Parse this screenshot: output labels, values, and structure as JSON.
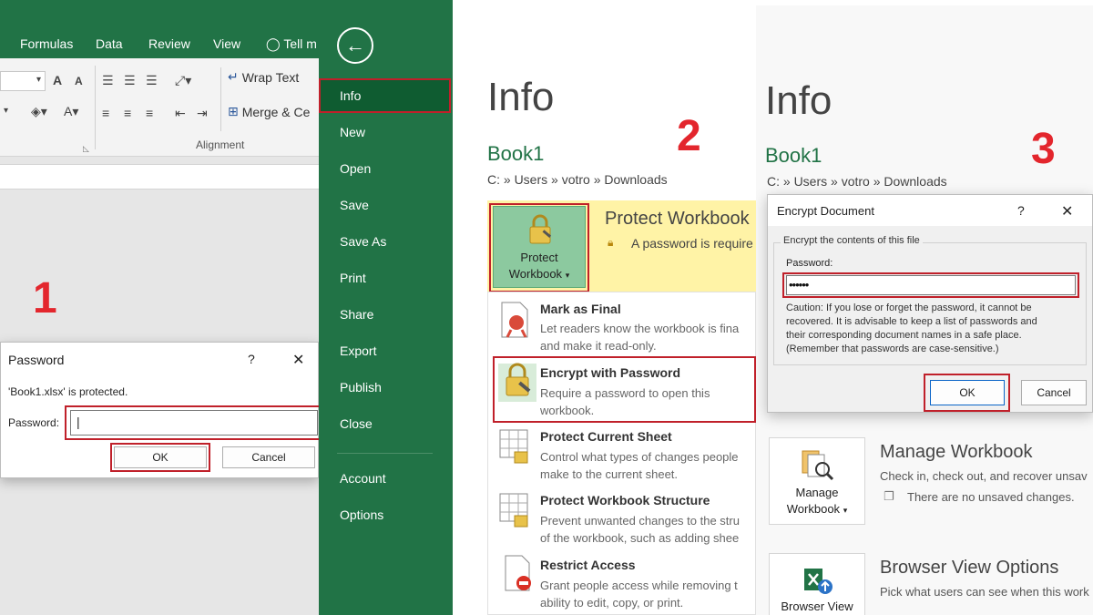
{
  "panel1": {
    "tabs": [
      "Formulas",
      "Data",
      "Review",
      "View",
      "Tell m"
    ],
    "ribbon": {
      "wrap_text": "Wrap Text",
      "merge": "Merge & Ce",
      "alignment": "Alignment",
      "font_increase": "A",
      "font_decrease": "A",
      "font_color": "A"
    },
    "step": "1",
    "dialog": {
      "title": "Password",
      "help": "?",
      "close": "✕",
      "message": "'Book1.xlsx' is protected.",
      "password_label": "Password:",
      "ok": "OK",
      "cancel": "Cancel"
    }
  },
  "panel2": {
    "nav": [
      "Info",
      "New",
      "Open",
      "Save",
      "Save As",
      "Print",
      "Share",
      "Export",
      "Publish",
      "Close",
      "Account",
      "Options"
    ],
    "back_icon": "back-arrow-icon",
    "step": "2",
    "info_title": "Info",
    "book": "Book1",
    "path": "C: » Users » votro » Downloads",
    "protect": {
      "button_line1": "Protect",
      "button_line2": "Workbook",
      "title": "Protect Workbook",
      "desc": "A password is require"
    },
    "options": [
      {
        "title": "Mark as Final",
        "desc1": "Let readers know the workbook is fina",
        "desc2": "and make it read-only."
      },
      {
        "title": "Encrypt with Password",
        "desc1": "Require a password to open this",
        "desc2": "workbook."
      },
      {
        "title": "Protect Current Sheet",
        "desc1": "Control what types of changes people",
        "desc2": "make to the current sheet."
      },
      {
        "title": "Protect Workbook Structure",
        "desc1": "Prevent unwanted changes to the stru",
        "desc2": "of the workbook, such as adding shee"
      },
      {
        "title": "Restrict Access",
        "desc1": "Grant people access while removing t",
        "desc2": "ability to edit, copy, or print."
      }
    ]
  },
  "panel3": {
    "step": "3",
    "info_title": "Info",
    "book": "Book1",
    "path": "C: » Users » votro » Downloads",
    "dialog": {
      "title": "Encrypt Document",
      "help": "?",
      "close": "✕",
      "group": "Encrypt the contents of this file",
      "password_label": "Password:",
      "password_value": "••••••",
      "caution1": "Caution: If you lose or forget the password, it cannot be",
      "caution2": "recovered. It is advisable to keep a list of passwords and",
      "caution3": "their corresponding document names in a safe place.",
      "caution4": "(Remember that passwords are case-sensitive.)",
      "ok": "OK",
      "cancel": "Cancel"
    },
    "manage": {
      "button_line1": "Manage",
      "button_line2": "Workbook",
      "title": "Manage Workbook",
      "desc1": "Check in, check out, and recover unsav",
      "desc2": "There are no unsaved changes."
    },
    "browser": {
      "button_line1": "Browser View",
      "title": "Browser View Options",
      "desc1": "Pick what users can see when this work"
    }
  },
  "colors": {
    "excel_green": "#217346",
    "highlight_red": "#c0202a",
    "step_red": "#e3262d",
    "protect_yellow": "#fff3a6"
  }
}
